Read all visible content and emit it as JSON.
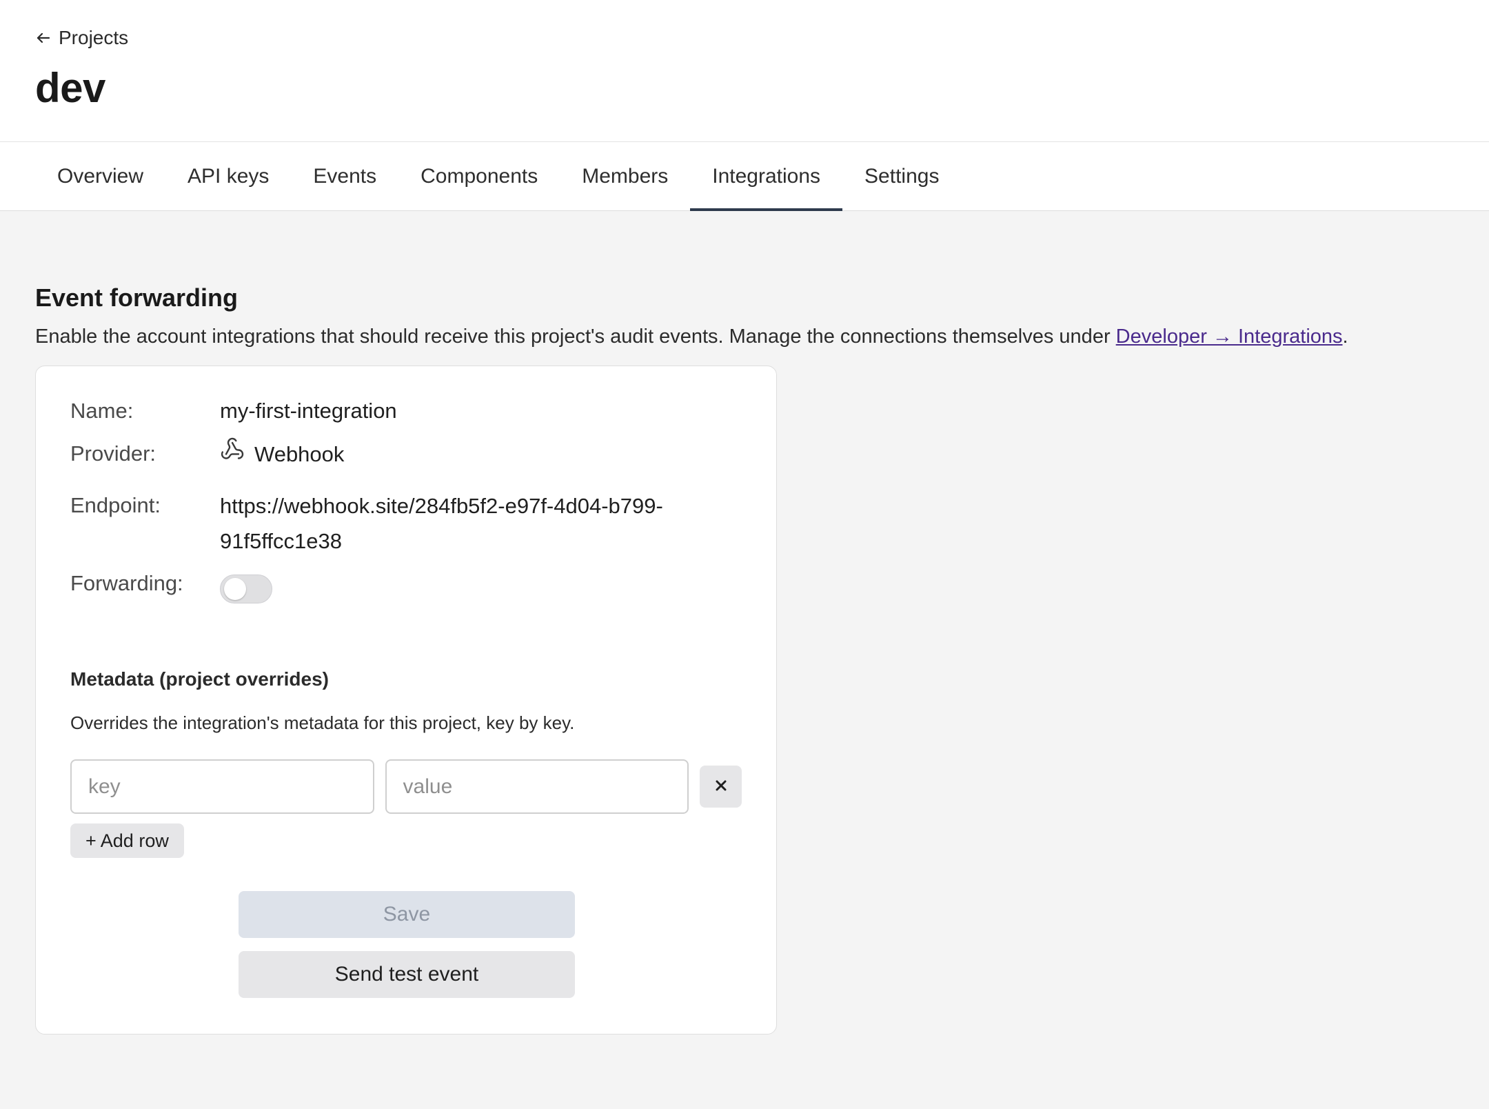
{
  "header": {
    "back_link_label": "Projects",
    "back_icon": "arrow-left-icon",
    "title": "dev"
  },
  "tabs": [
    {
      "label": "Overview",
      "active": false
    },
    {
      "label": "API keys",
      "active": false
    },
    {
      "label": "Events",
      "active": false
    },
    {
      "label": "Components",
      "active": false
    },
    {
      "label": "Members",
      "active": false
    },
    {
      "label": "Integrations",
      "active": true
    },
    {
      "label": "Settings",
      "active": false
    }
  ],
  "section": {
    "title": "Event forwarding",
    "description_prefix": "Enable the account integrations that should receive this project's audit events. Manage the connections themselves under ",
    "description_link": "Developer → Integrations",
    "description_suffix": "."
  },
  "integration": {
    "name_label": "Name:",
    "name_value": "my-first-integration",
    "provider_label": "Provider:",
    "provider_icon": "webhook-icon",
    "provider_value": "Webhook",
    "endpoint_label": "Endpoint:",
    "endpoint_value": "https://webhook.site/284fb5f2-e97f-4d04-b799-91f5ffcc1e38",
    "forwarding_label": "Forwarding:",
    "forwarding_enabled": false
  },
  "metadata": {
    "title": "Metadata (project overrides)",
    "description": "Overrides the integration's metadata for this project, key by key.",
    "key_placeholder": "key",
    "value_placeholder": "value",
    "remove_icon": "close-icon",
    "add_row_label": "+ Add row"
  },
  "actions": {
    "save_label": "Save",
    "test_label": "Send test event"
  },
  "colors": {
    "active_tab_underline": "#2e3a4d",
    "link": "#4a2a8c",
    "page_background": "#f4f4f4"
  }
}
